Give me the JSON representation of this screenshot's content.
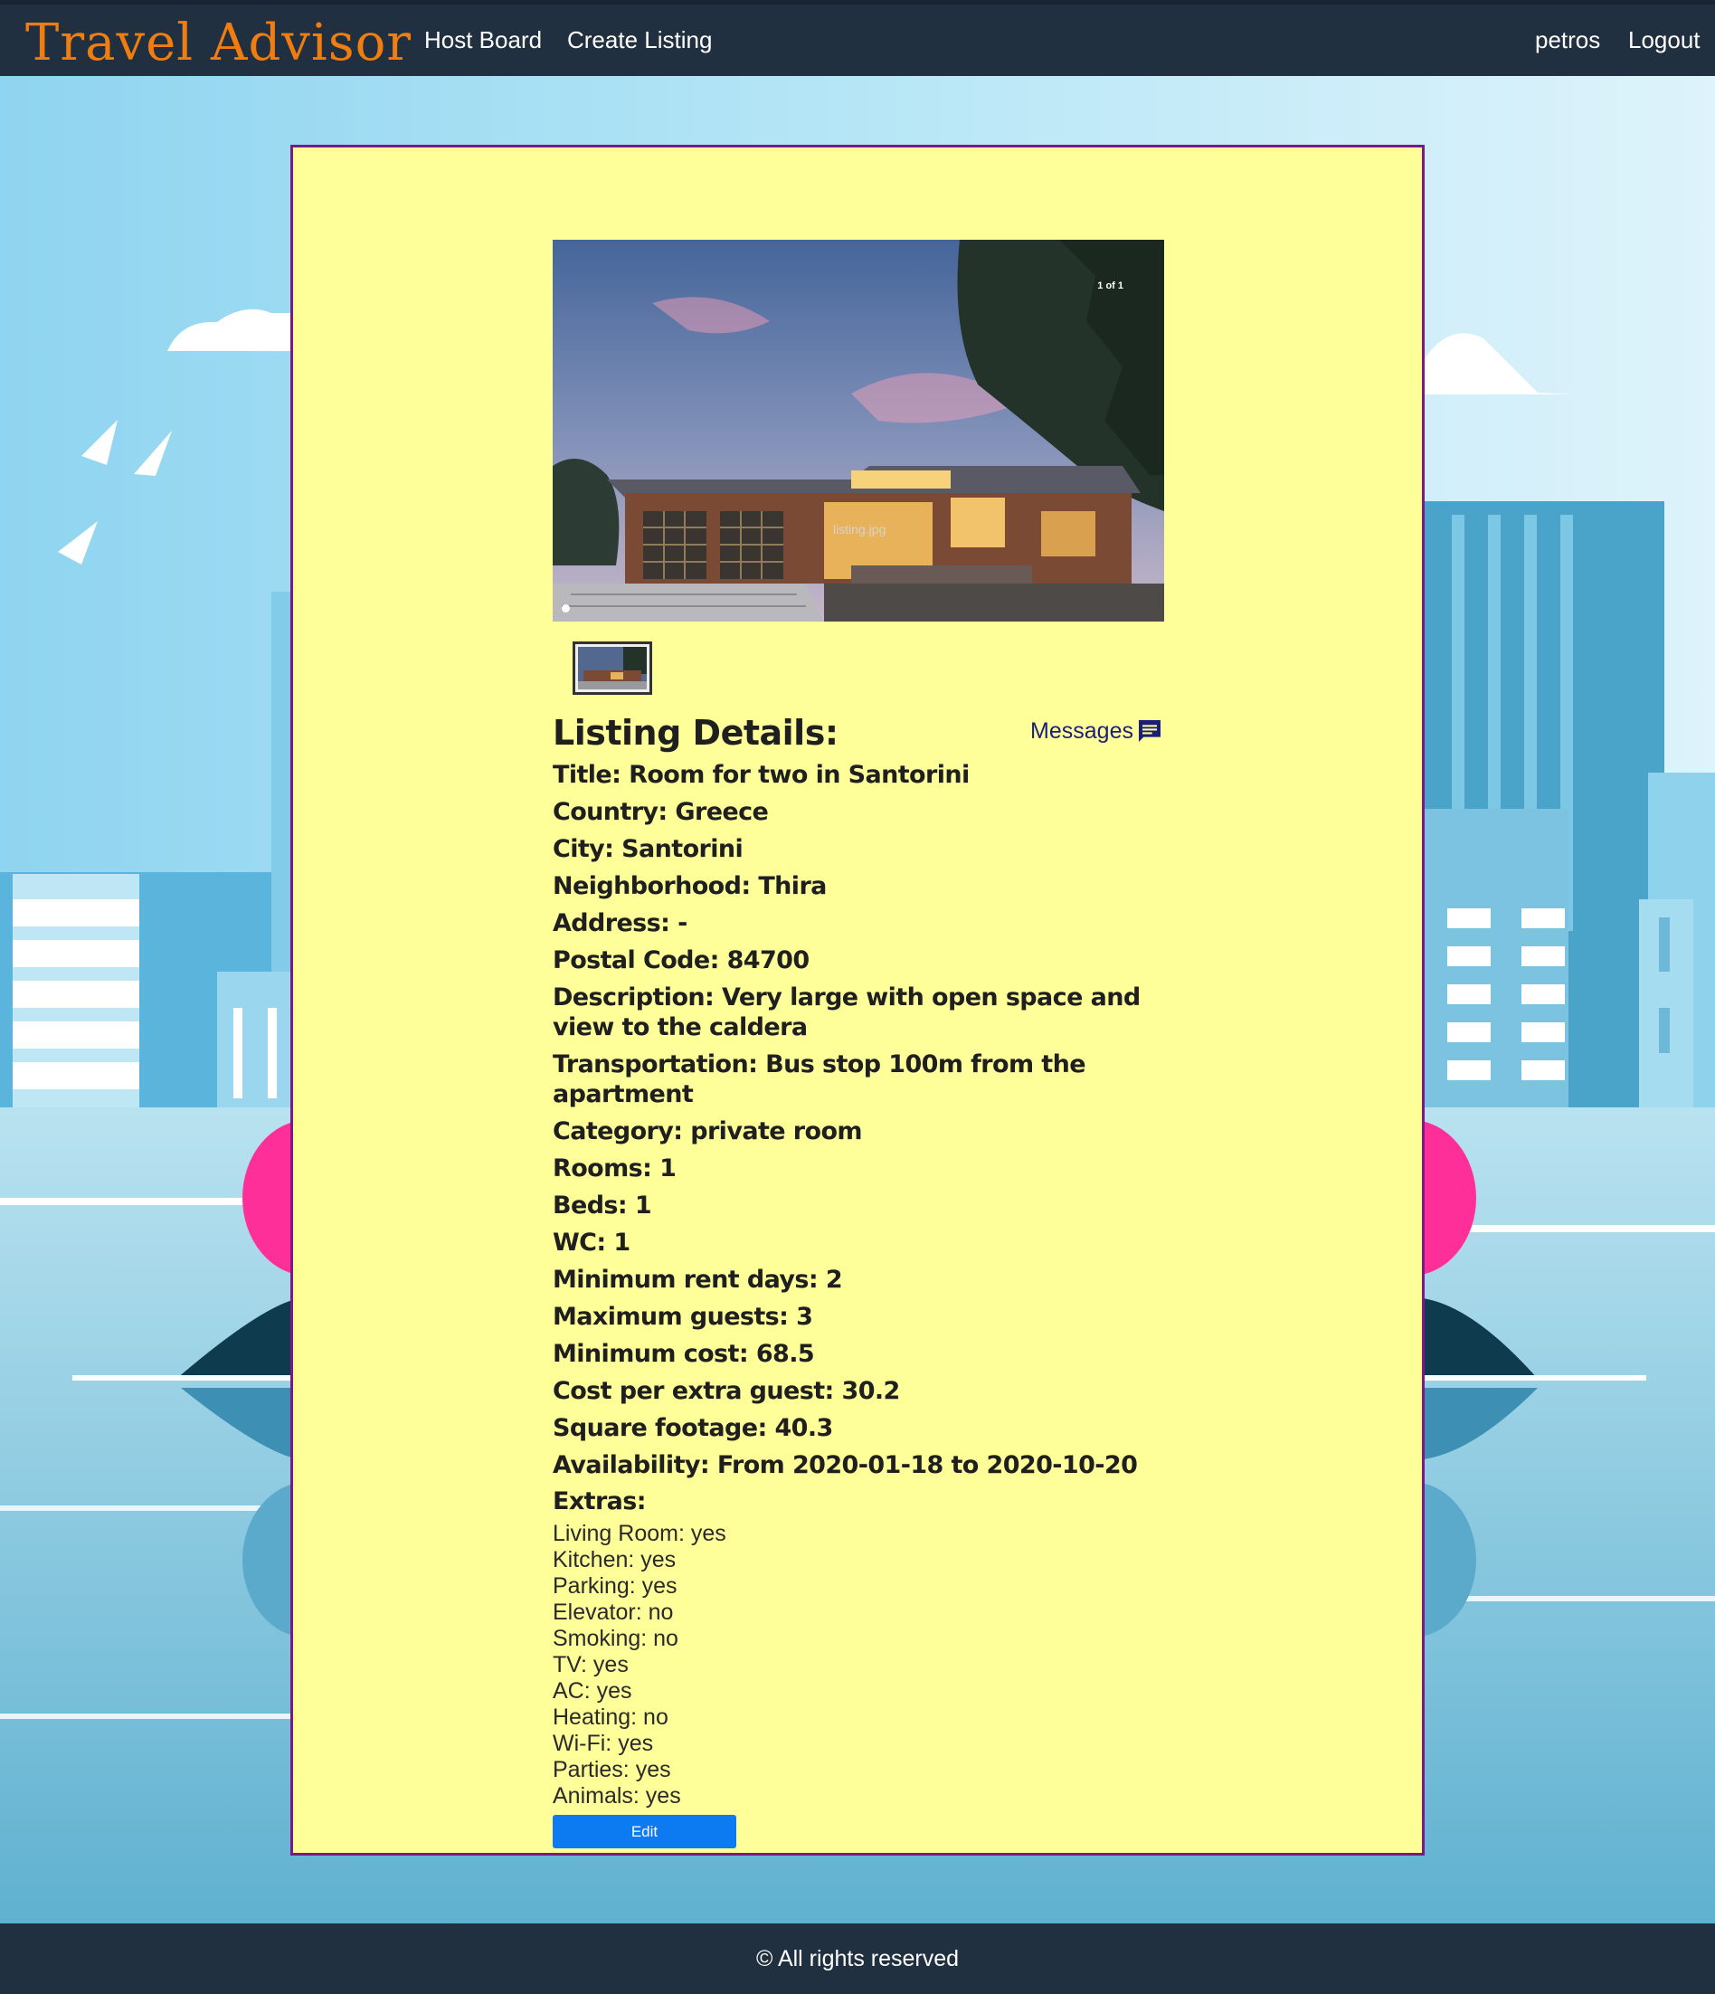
{
  "navbar": {
    "brand": "Travel Advisor",
    "links": {
      "host_board": "Host Board",
      "create_listing": "Create Listing"
    },
    "user": {
      "username": "petros",
      "logout": "Logout"
    }
  },
  "carousel": {
    "counter": "1 of 1",
    "image_alt": "listing.jpg"
  },
  "details": {
    "heading": "Listing Details:",
    "messages_label": "Messages",
    "fields": [
      "Title: Room for two in Santorini",
      "Country: Greece",
      "City: Santorini",
      "Neighborhood: Thira",
      "Address: -",
      "Postal Code: 84700",
      "Description: Very large with open space and view to the caldera",
      "Transportation: Bus stop 100m from the apartment",
      "Category: private room",
      "Rooms: 1",
      "Beds: 1",
      "WC: 1",
      "Minimum rent days: 2",
      "Maximum guests: 3",
      "Minimum cost: 68.5",
      "Cost per extra guest: 30.2",
      "Square footage: 40.3",
      "Availability: From 2020-01-18 to 2020-10-20"
    ],
    "extras_heading": "Extras:",
    "extras": [
      "Living Room: yes",
      "Kitchen: yes",
      "Parking: yes",
      "Elevator: no",
      "Smoking: no",
      "TV: yes",
      "AC: yes",
      "Heating: no",
      "Wi-Fi: yes",
      "Parties: yes",
      "Animals: yes"
    ],
    "edit_label": "Edit"
  },
  "footer": {
    "text": "© All rights reserved"
  },
  "colors": {
    "navbar": "#213040",
    "brand": "#f07d10",
    "card_bg": "#ffff99",
    "card_border": "#7b1a86",
    "edit_button": "#0c7af0",
    "messages_link": "#1b1f7a"
  }
}
